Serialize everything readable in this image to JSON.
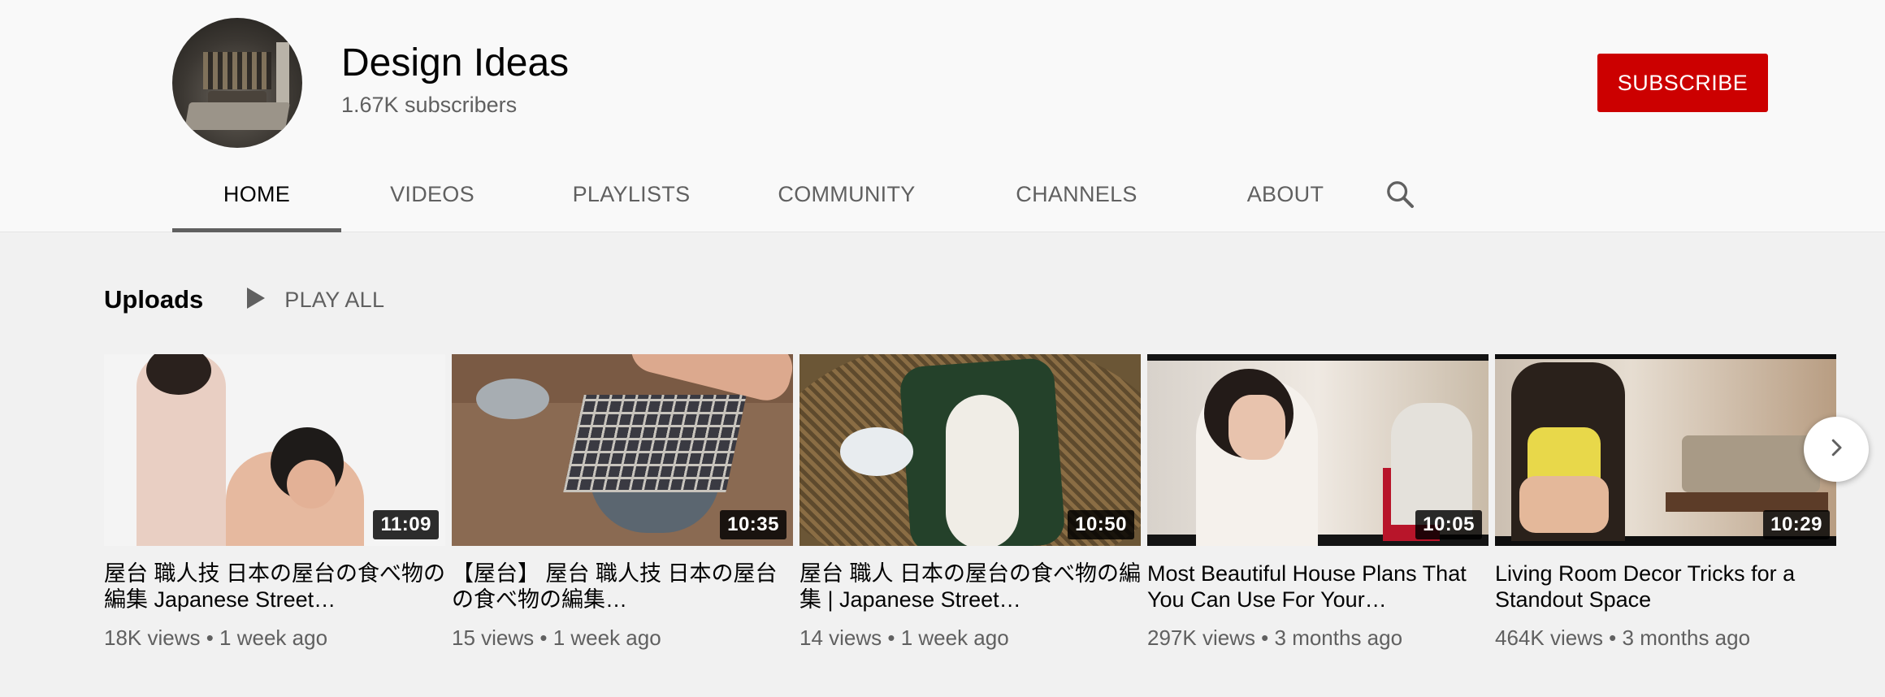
{
  "channel": {
    "title": "Design Ideas",
    "subscribers": "1.67K subscribers",
    "subscribe_label": "SUBSCRIBE"
  },
  "tabs": [
    {
      "label": "HOME",
      "active": true
    },
    {
      "label": "VIDEOS",
      "active": false
    },
    {
      "label": "PLAYLISTS",
      "active": false
    },
    {
      "label": "COMMUNITY",
      "active": false
    },
    {
      "label": "CHANNELS",
      "active": false
    },
    {
      "label": "ABOUT",
      "active": false
    }
  ],
  "search_icon": "search-icon",
  "uploads": {
    "title": "Uploads",
    "play_all_label": "PLAY ALL"
  },
  "videos": [
    {
      "title": "屋台 職人技 日本の屋台の食べ物の編集 Japanese Street…",
      "meta": "18K views • 1 week ago",
      "duration": "11:09"
    },
    {
      "title": "【屋台】 屋台 職人技 日本の屋台の食べ物の編集…",
      "meta": "15 views • 1 week ago",
      "duration": "10:35"
    },
    {
      "title": "屋台 職人 日本の屋台の食べ物の編集 | Japanese Street…",
      "meta": "14 views • 1 week ago",
      "duration": "10:50"
    },
    {
      "title": "Most Beautiful House Plans That You Can Use For Your…",
      "meta": "297K views • 3 months ago",
      "duration": "10:05"
    },
    {
      "title": "Living Room Decor Tricks for a Standout Space",
      "meta": "464K views • 3 months ago",
      "duration": "10:29"
    }
  ],
  "colors": {
    "subscribe_bg": "#cc0000",
    "header_bg": "#f9f9f9",
    "page_bg": "#f1f1f1",
    "secondary_text": "#606060"
  }
}
